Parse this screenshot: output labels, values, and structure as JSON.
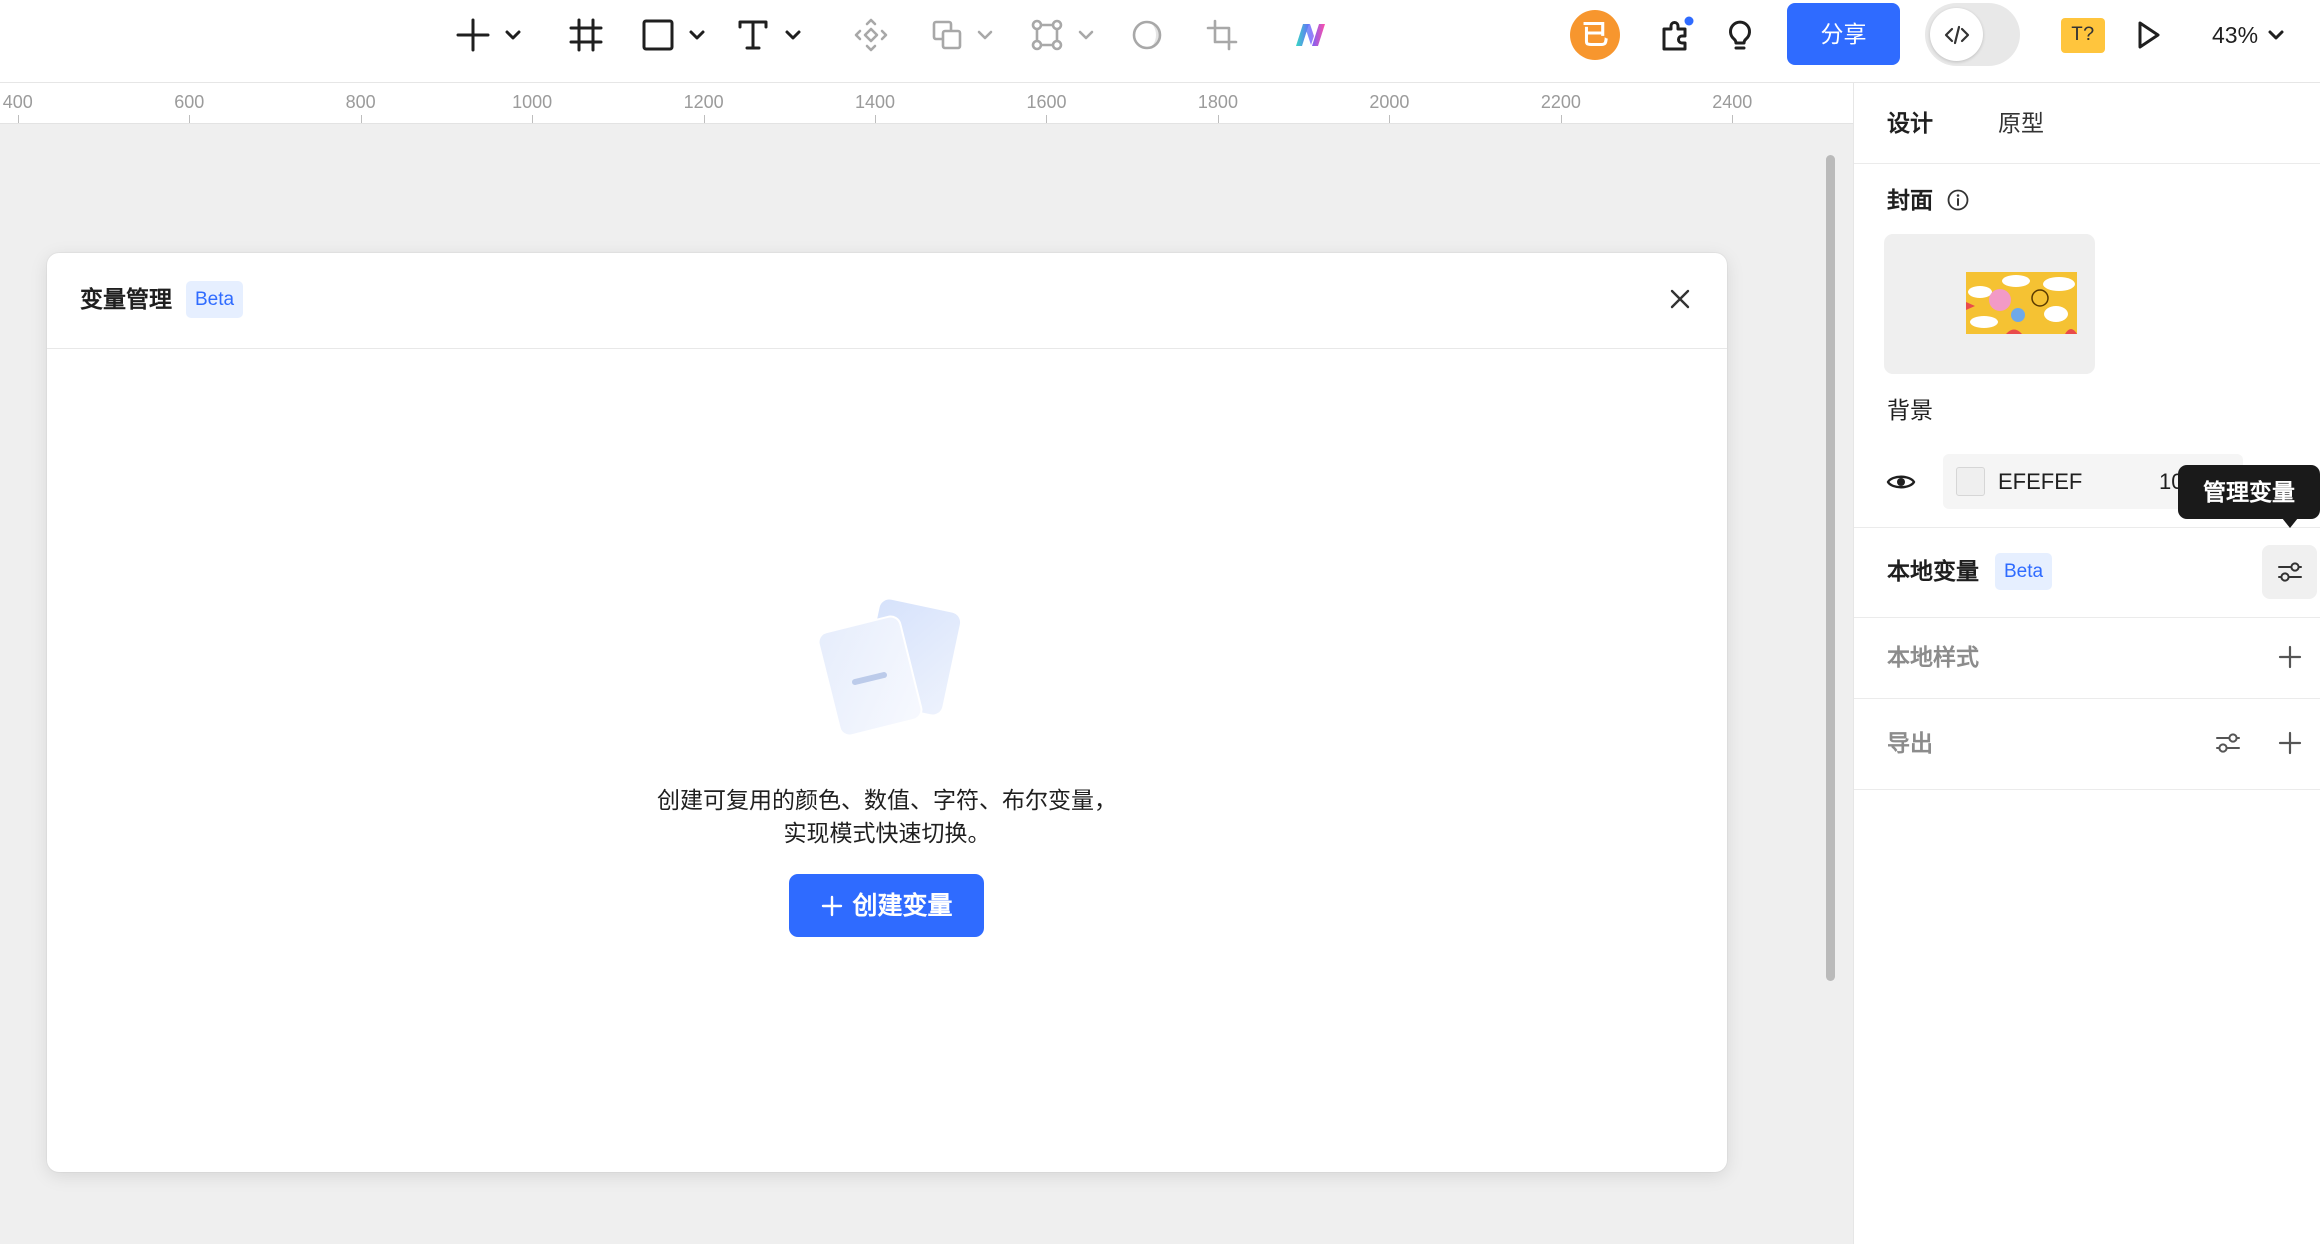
{
  "toolbar": {
    "tools": [
      {
        "icon": "plus-icon",
        "dropdown": true,
        "enabled": true
      },
      {
        "icon": "frame-icon",
        "dropdown": false,
        "enabled": true
      },
      {
        "icon": "rectangle-icon",
        "dropdown": true,
        "enabled": true
      },
      {
        "icon": "text-tool-icon",
        "dropdown": true,
        "enabled": true
      },
      {
        "icon": "component-icon",
        "dropdown": false,
        "enabled": false
      },
      {
        "icon": "boolean-icon",
        "dropdown": true,
        "enabled": false
      },
      {
        "icon": "vector-edit-icon",
        "dropdown": true,
        "enabled": false
      },
      {
        "icon": "mask-icon",
        "dropdown": false,
        "enabled": false
      },
      {
        "icon": "crop-icon",
        "dropdown": false,
        "enabled": false
      },
      {
        "icon": "ai-logo-icon",
        "dropdown": false,
        "enabled": true
      }
    ],
    "avatar_text": "已",
    "share_label": "分享",
    "font_warning_label": "T?",
    "zoom_label": "43%"
  },
  "ruler": {
    "labels": [
      "400",
      "600",
      "800",
      "1000",
      "1200",
      "1400",
      "1600",
      "1800",
      "2000",
      "2200",
      "2400"
    ]
  },
  "modal": {
    "title": "变量管理",
    "badge": "Beta",
    "empty_line1": "创建可复用的颜色、数值、字符、布尔变量，",
    "empty_line2": "实现模式快速切换。",
    "create_button_label": "创建变量"
  },
  "panel": {
    "tabs": [
      {
        "label": "设计",
        "active": true
      },
      {
        "label": "原型",
        "active": false
      }
    ],
    "cover": {
      "label": "封面"
    },
    "background": {
      "label": "背景",
      "color_hex": "EFEFEF",
      "opacity_text": "10",
      "visible": true
    },
    "tooltip": "管理变量",
    "local_variables": {
      "label": "本地变量",
      "badge": "Beta"
    },
    "local_styles": {
      "label": "本地样式"
    },
    "export": {
      "label": "导出"
    }
  },
  "colors": {
    "accent": "#2F6BFF",
    "canvas": "#EFEFEF",
    "avatar": "#F7962E",
    "warning_badge": "#FFC53D",
    "tooltip_bg": "#1A1A1A"
  }
}
